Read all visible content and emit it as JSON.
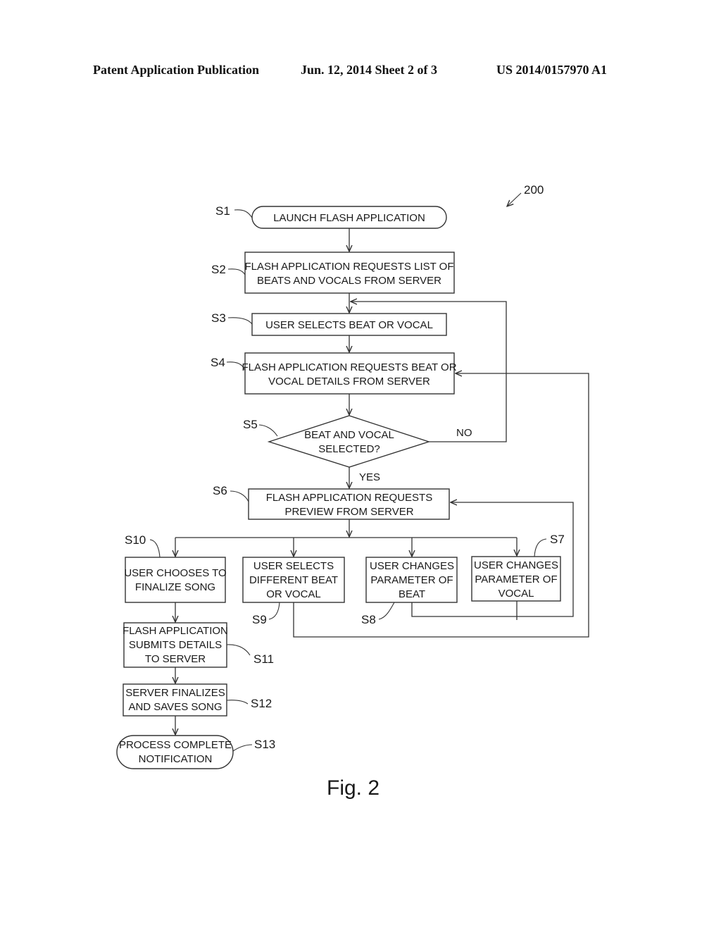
{
  "header": {
    "publication": "Patent Application Publication",
    "date_sheet": "Jun. 12, 2014   Sheet 2 of 3",
    "number": "US 2014/0157970 A1"
  },
  "diagram": {
    "reference": "200",
    "figure_label": "Fig. 2",
    "nodes": {
      "s1": {
        "step": "S1",
        "lines": [
          "LAUNCH FLASH APPLICATION"
        ]
      },
      "s2": {
        "step": "S2",
        "lines": [
          "FLASH APPLICATION REQUESTS LIST OF",
          "BEATS AND VOCALS FROM SERVER"
        ]
      },
      "s3": {
        "step": "S3",
        "lines": [
          "USER SELECTS BEAT OR VOCAL"
        ]
      },
      "s4": {
        "step": "S4",
        "lines": [
          "FLASH APPLICATION REQUESTS BEAT OR",
          "VOCAL DETAILS FROM SERVER"
        ]
      },
      "s5": {
        "step": "S5",
        "lines": [
          "BEAT AND VOCAL",
          "SELECTED?"
        ]
      },
      "s6": {
        "step": "S6",
        "lines": [
          "FLASH APPLICATION REQUESTS",
          "PREVIEW FROM SERVER"
        ]
      },
      "s7": {
        "step": "S7",
        "lines": [
          "USER CHANGES",
          "PARAMETER OF",
          "VOCAL"
        ]
      },
      "s8": {
        "step": "S8",
        "lines": [
          "USER CHANGES",
          "PARAMETER OF",
          "BEAT"
        ]
      },
      "s9": {
        "step": "S9",
        "lines": [
          "USER SELECTS",
          "DIFFERENT BEAT",
          "OR VOCAL"
        ]
      },
      "s10": {
        "step": "S10",
        "lines": [
          "USER CHOOSES TO",
          "FINALIZE SONG"
        ]
      },
      "s11": {
        "step": "S11",
        "lines": [
          "FLASH APPLICATION",
          "SUBMITS DETAILS",
          "TO SERVER"
        ]
      },
      "s12": {
        "step": "S12",
        "lines": [
          "SERVER FINALIZES",
          "AND SAVES SONG"
        ]
      },
      "s13": {
        "step": "S13",
        "lines": [
          "PROCESS COMPLETE",
          "NOTIFICATION"
        ]
      }
    },
    "branch_labels": {
      "no": "NO",
      "yes": "YES"
    }
  }
}
